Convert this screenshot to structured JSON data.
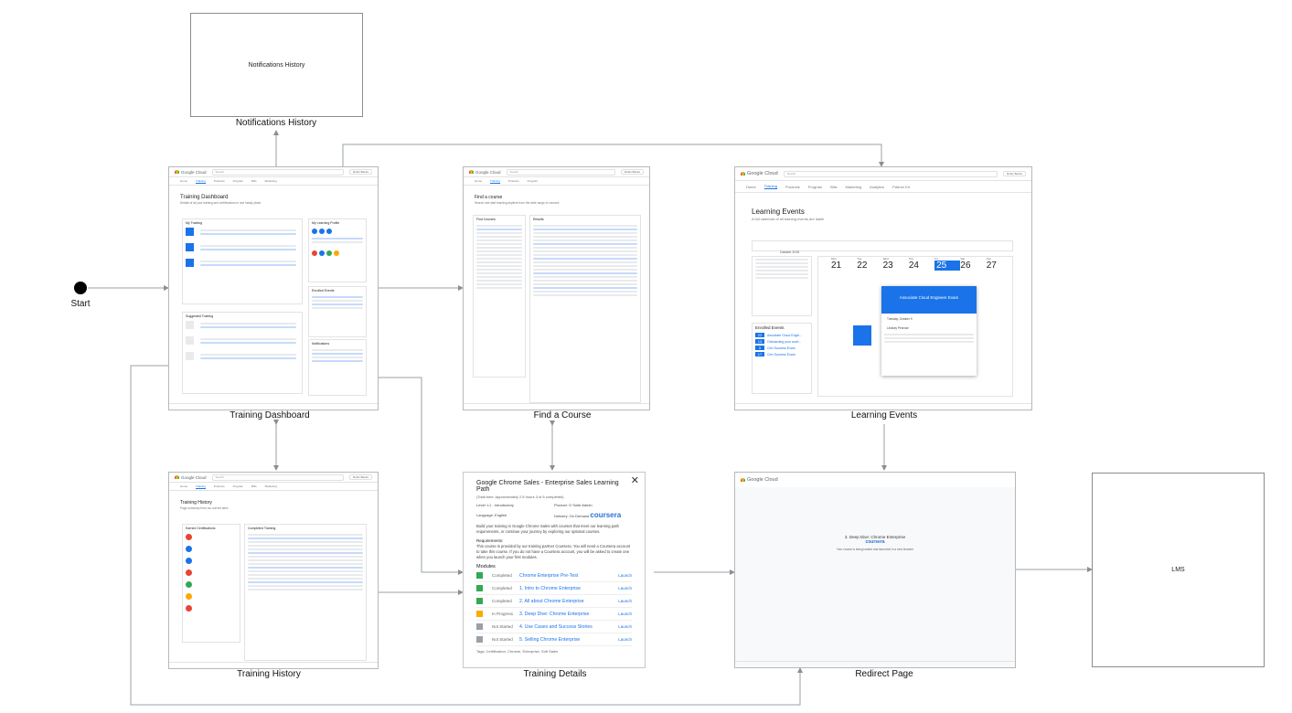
{
  "start": {
    "label": "Start"
  },
  "nodes": {
    "notifications_history": {
      "box_text": "Notifications History",
      "label": "Notifications History"
    },
    "training_dashboard": {
      "label": "Training Dashboard",
      "title": "Training Dashboard",
      "subtitle": "Details of all your training and certifications in one handy place",
      "sections": [
        "My Training",
        "My Learning Profile",
        "Enrolled Events",
        "Notifications",
        "Suggested Training"
      ],
      "partner": "coursera"
    },
    "find_a_course": {
      "label": "Find a Course",
      "title": "Find a course",
      "subtitle": "Search and start learning anytime from the wide range of courses",
      "filter_heading": "Find Courses",
      "results_heading": "Results"
    },
    "learning_events": {
      "label": "Learning Events",
      "title": "Learning Events",
      "subtitle": "A full calendar of all training events are liable",
      "month": "October 2019",
      "enrolled_heading": "Enrolled Events",
      "days": [
        {
          "name": "Mon",
          "num": "21"
        },
        {
          "name": "Tue",
          "num": "22"
        },
        {
          "name": "Wed",
          "num": "23"
        },
        {
          "name": "Thu",
          "num": "24"
        },
        {
          "name": "Fri",
          "num": "25"
        },
        {
          "name": "Sat",
          "num": "26"
        },
        {
          "name": "Sun",
          "num": "27"
        }
      ],
      "enrolled": [
        {
          "date": "22",
          "title": "Associate Cloud Engin..."
        },
        {
          "date": "14",
          "title": "Onboarding your work..."
        },
        {
          "date": "5",
          "title": "Cert Success Exam"
        },
        {
          "date": "17",
          "title": "Cert Success Exam"
        }
      ],
      "popup_title": "Associate Cloud Engineer Exam",
      "popup_date": "Tuesday, October 9",
      "popup_place": "Lindsey Penrose"
    },
    "training_history": {
      "label": "Training History",
      "title": "Training History",
      "subtitle": "Page summary from our current sites",
      "left_heading": "Earned Certifications",
      "right_heading": "Completed Training"
    },
    "training_details": {
      "label": "Training Details",
      "close": "✕",
      "title": "Google Chrome Sales - Enterprise Sales Learning Path",
      "meta": "(Total time: Approximately 2.5 hours     3 of 6 completed)",
      "level": "Level: L1 - Introductory",
      "product": "Product: G Suite Admin",
      "language": "Language: English",
      "delivery": "Delivery: On Demand",
      "partner": "coursera",
      "description": "Build your training in Google Chrome Sales with courses that meet our learning path requirements, or continue your journey by exploring our optional courses.",
      "requirements_heading": "Requirements:",
      "requirements": "This course is provided by our training partner Coursera. You will need a Coursera account to take this course. If you do not have a Coursera account, you will be asked to create one when you launch your first modules.",
      "modules_heading": "Modules",
      "modules": [
        {
          "status": "Completed",
          "name": "Chrome Enterprise Pre-Test",
          "link": "Launch",
          "color": "#34a853"
        },
        {
          "status": "Completed",
          "name": "1. Intro to Chrome Enterprise",
          "link": "Launch",
          "color": "#34a853"
        },
        {
          "status": "Completed",
          "name": "2. All about Chrome Enterprise",
          "link": "Launch",
          "color": "#34a853"
        },
        {
          "status": "In Progress",
          "name": "3. Deep Dive: Chrome Enterprise",
          "link": "Launch",
          "color": "#f9ab00"
        },
        {
          "status": "Not Started",
          "name": "4. Use Cases and Success Stories",
          "link": "Launch",
          "color": "#9aa0a6"
        },
        {
          "status": "Not Started",
          "name": "5. Selling Chrome Enterprise",
          "link": "Launch",
          "color": "#9aa0a6"
        }
      ],
      "tags": "Tags: Certification, Chrome, Enterprise, Soft Sales"
    },
    "redirect_page": {
      "label": "Redirect Page",
      "heading": "3. Deep Dive: Chrome Enterprise",
      "partner": "coursera",
      "message": "Your course is being loaded and launched in a new browser"
    },
    "lms": {
      "box_text": "LMS"
    }
  },
  "brand": {
    "logo": "Google Cloud",
    "user": "Robin Banks"
  },
  "nav_items": [
    "Home",
    "Training",
    "Products",
    "Program",
    "Bills",
    "Marketing",
    "Analytics",
    "Partner Kit"
  ],
  "colors": {
    "accent": "#1a73e8",
    "edge": "#9aa0a6",
    "frame_border": "#b8b8b8"
  }
}
